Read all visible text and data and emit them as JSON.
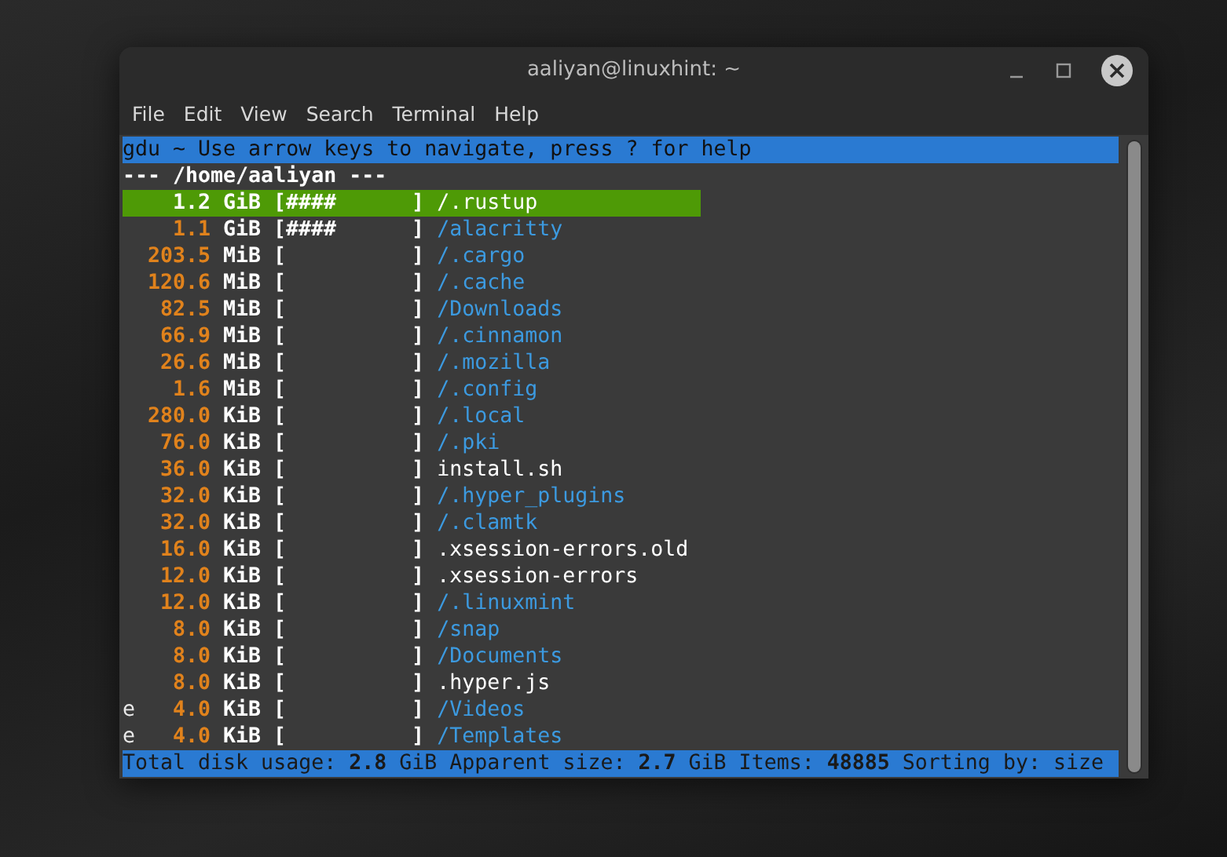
{
  "window": {
    "title": "aaliyan@linuxhint: ~"
  },
  "menu": [
    "File",
    "Edit",
    "View",
    "Search",
    "Terminal",
    "Help"
  ],
  "terminal": {
    "header": "gdu ~ Use arrow keys to navigate, press ? for help",
    "path": "--- /home/aaliyan ---",
    "rows": [
      {
        "flag": "",
        "size": "1.2",
        "unit": "GiB",
        "bar": "[####      ]",
        "name": "/.rustup",
        "kind": "dir",
        "selected": true
      },
      {
        "flag": "",
        "size": "1.1",
        "unit": "GiB",
        "bar": "[####      ]",
        "name": "/alacritty",
        "kind": "dir",
        "selected": false
      },
      {
        "flag": "",
        "size": "203.5",
        "unit": "MiB",
        "bar": "[          ]",
        "name": "/.cargo",
        "kind": "dir",
        "selected": false
      },
      {
        "flag": "",
        "size": "120.6",
        "unit": "MiB",
        "bar": "[          ]",
        "name": "/.cache",
        "kind": "dir",
        "selected": false
      },
      {
        "flag": "",
        "size": "82.5",
        "unit": "MiB",
        "bar": "[          ]",
        "name": "/Downloads",
        "kind": "dir",
        "selected": false
      },
      {
        "flag": "",
        "size": "66.9",
        "unit": "MiB",
        "bar": "[          ]",
        "name": "/.cinnamon",
        "kind": "dir",
        "selected": false
      },
      {
        "flag": "",
        "size": "26.6",
        "unit": "MiB",
        "bar": "[          ]",
        "name": "/.mozilla",
        "kind": "dir",
        "selected": false
      },
      {
        "flag": "",
        "size": "1.6",
        "unit": "MiB",
        "bar": "[          ]",
        "name": "/.config",
        "kind": "dir",
        "selected": false
      },
      {
        "flag": "",
        "size": "280.0",
        "unit": "KiB",
        "bar": "[          ]",
        "name": "/.local",
        "kind": "dir",
        "selected": false
      },
      {
        "flag": "",
        "size": "76.0",
        "unit": "KiB",
        "bar": "[          ]",
        "name": "/.pki",
        "kind": "dir",
        "selected": false
      },
      {
        "flag": "",
        "size": "36.0",
        "unit": "KiB",
        "bar": "[          ]",
        "name": "install.sh",
        "kind": "file",
        "selected": false
      },
      {
        "flag": "",
        "size": "32.0",
        "unit": "KiB",
        "bar": "[          ]",
        "name": "/.hyper_plugins",
        "kind": "dir",
        "selected": false
      },
      {
        "flag": "",
        "size": "32.0",
        "unit": "KiB",
        "bar": "[          ]",
        "name": "/.clamtk",
        "kind": "dir",
        "selected": false
      },
      {
        "flag": "",
        "size": "16.0",
        "unit": "KiB",
        "bar": "[          ]",
        "name": ".xsession-errors.old",
        "kind": "file",
        "selected": false
      },
      {
        "flag": "",
        "size": "12.0",
        "unit": "KiB",
        "bar": "[          ]",
        "name": ".xsession-errors",
        "kind": "file",
        "selected": false
      },
      {
        "flag": "",
        "size": "12.0",
        "unit": "KiB",
        "bar": "[          ]",
        "name": "/.linuxmint",
        "kind": "dir",
        "selected": false
      },
      {
        "flag": "",
        "size": "8.0",
        "unit": "KiB",
        "bar": "[          ]",
        "name": "/snap",
        "kind": "dir",
        "selected": false
      },
      {
        "flag": "",
        "size": "8.0",
        "unit": "KiB",
        "bar": "[          ]",
        "name": "/Documents",
        "kind": "dir",
        "selected": false
      },
      {
        "flag": "",
        "size": "8.0",
        "unit": "KiB",
        "bar": "[          ]",
        "name": ".hyper.js",
        "kind": "file",
        "selected": false
      },
      {
        "flag": "e",
        "size": "4.0",
        "unit": "KiB",
        "bar": "[          ]",
        "name": "/Videos",
        "kind": "dir",
        "selected": false
      },
      {
        "flag": "e",
        "size": "4.0",
        "unit": "KiB",
        "bar": "[          ]",
        "name": "/Templates",
        "kind": "dir",
        "selected": false
      }
    ],
    "status": "Total disk usage: **2.8** GiB Apparent size: **2.7** GiB Items: **48885** Sorting by: size"
  }
}
